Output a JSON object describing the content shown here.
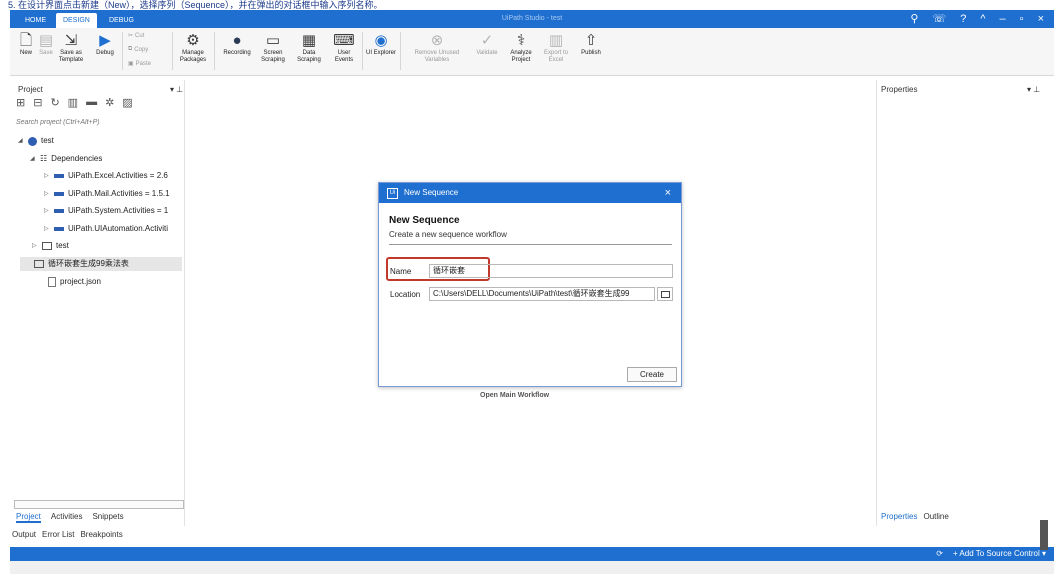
{
  "top_caption": "5. 在设计界面点击新建（New），选择序列（Sequence），并在弹出的对话框中输入序列名称。",
  "titlebar": {
    "tabs": [
      "HOME",
      "DESIGN",
      "DEBUG"
    ],
    "active_tab": "DESIGN",
    "title": "UiPath Studio - test",
    "icons": [
      "search-icon",
      "feedback-icon",
      "help-icon",
      "collapse-icon",
      "minimize-icon",
      "restore-icon",
      "close-icon"
    ]
  },
  "ribbon": {
    "new": "New",
    "save": "Save",
    "save_as_template": "Save as Template",
    "debug": "Debug",
    "cut": "Cut",
    "copy": "Copy",
    "paste": "Paste",
    "manage_packages": "Manage Packages",
    "recording": "Recording",
    "screen_scraping": "Screen Scraping",
    "data_scraping": "Data Scraping",
    "user_events": "User Events",
    "ui_explorer": "UI Explorer",
    "remove_unused_variables": "Remove Unused Variables",
    "validate": "Validate",
    "analyze_project": "Analyze Project",
    "export_to_excel": "Export to Excel",
    "publish": "Publish"
  },
  "project_panel": {
    "title": "Project",
    "search_placeholder": "Search project (Ctrl+Alt+P)",
    "tree": [
      {
        "label": "test"
      },
      {
        "label": "Dependencies"
      },
      {
        "label": "UiPath.Excel.Activities = 2.6"
      },
      {
        "label": "UiPath.Mail.Activities = 1.5.1"
      },
      {
        "label": "UiPath.System.Activities = 1"
      },
      {
        "label": "UiPath.UIAutomation.Activiti"
      },
      {
        "label": "test"
      },
      {
        "label": "循环嵌套生成99乘法表"
      },
      {
        "label": "project.json"
      }
    ],
    "tabs": [
      "Project",
      "Activities",
      "Snippets"
    ]
  },
  "output_tabs": [
    "Output",
    "Error List",
    "Breakpoints"
  ],
  "properties_panel": {
    "title": "Properties",
    "tabs": [
      "Properties",
      "Outline"
    ]
  },
  "canvas": {
    "open_main_workflow": "Open Main Workflow"
  },
  "dialog": {
    "title": "New Sequence",
    "heading": "New Sequence",
    "subtitle": "Create a new sequence workflow",
    "name_label": "Name",
    "name_value": "循环嵌套",
    "location_label": "Location",
    "location_value": "C:\\Users\\DELL\\Documents\\UiPath\\test\\循环嵌套生成99",
    "create_button": "Create"
  },
  "statusbar": {
    "add_to_source_control": "Add To Source Control"
  },
  "colors": {
    "accent": "#1e6fd0",
    "highlight": "#c0392b"
  }
}
